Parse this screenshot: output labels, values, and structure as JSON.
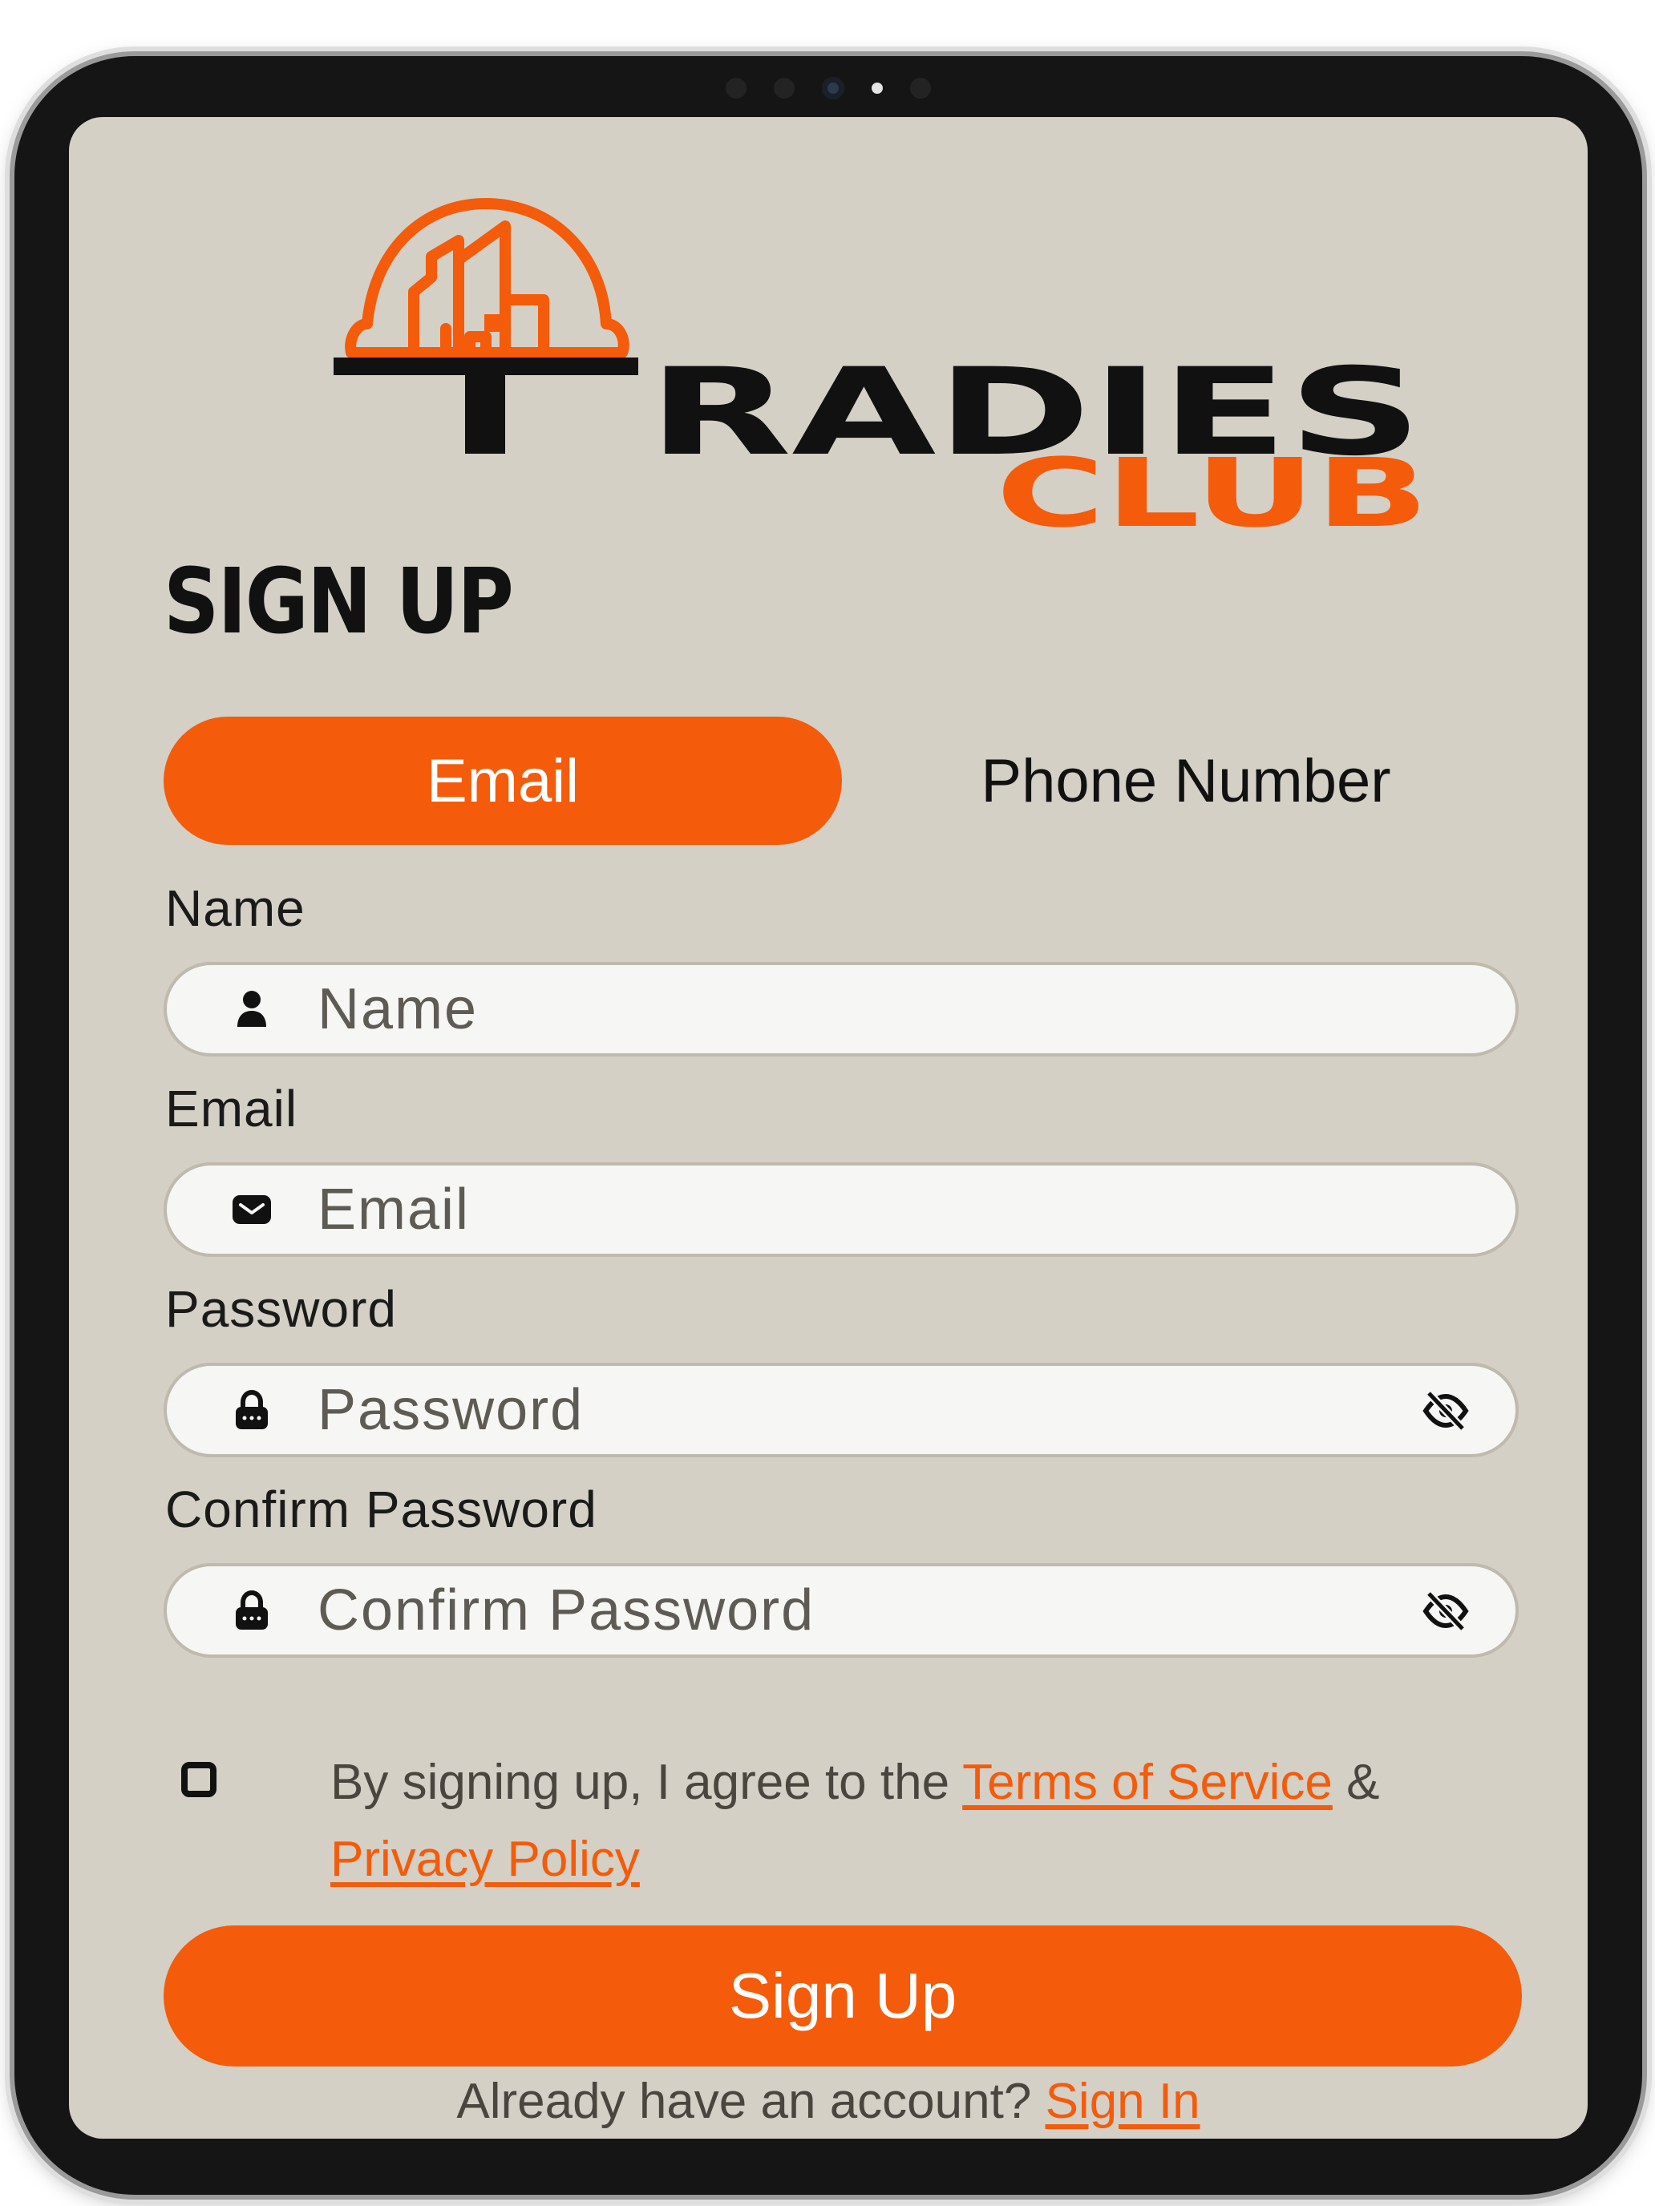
{
  "brand": {
    "line1": "RADIES",
    "line2": "CLUB",
    "accent_color": "#f45b0a",
    "dark_color": "#111111"
  },
  "page": {
    "title": "SIGN UP"
  },
  "tabs": [
    {
      "label": "Email",
      "active": true
    },
    {
      "label": "Phone Number",
      "active": false
    }
  ],
  "form": {
    "name": {
      "label": "Name",
      "placeholder": "Name",
      "value": "",
      "icon": "person-icon"
    },
    "email": {
      "label": "Email",
      "placeholder": "Email",
      "value": "",
      "icon": "envelope-icon"
    },
    "password": {
      "label": "Password",
      "placeholder": "Password",
      "value": "",
      "icon": "lock-icon",
      "toggle_icon": "eye-slash-icon"
    },
    "confirm_password": {
      "label": "Confirm Password",
      "placeholder": "Confirm Password",
      "value": "",
      "icon": "lock-icon",
      "toggle_icon": "eye-slash-icon"
    }
  },
  "terms": {
    "checked": false,
    "prefix": "By signing up, I agree to the ",
    "tos_link": "Terms of Service",
    "joiner": " & ",
    "privacy_link": "Privacy Policy"
  },
  "submit": {
    "label": "Sign Up"
  },
  "footer": {
    "prompt": "Already have an account? ",
    "link": "Sign In"
  },
  "colors": {
    "screen_bg": "#d4d0c6",
    "input_bg": "#f6f6f4",
    "accent": "#f45b0a"
  }
}
